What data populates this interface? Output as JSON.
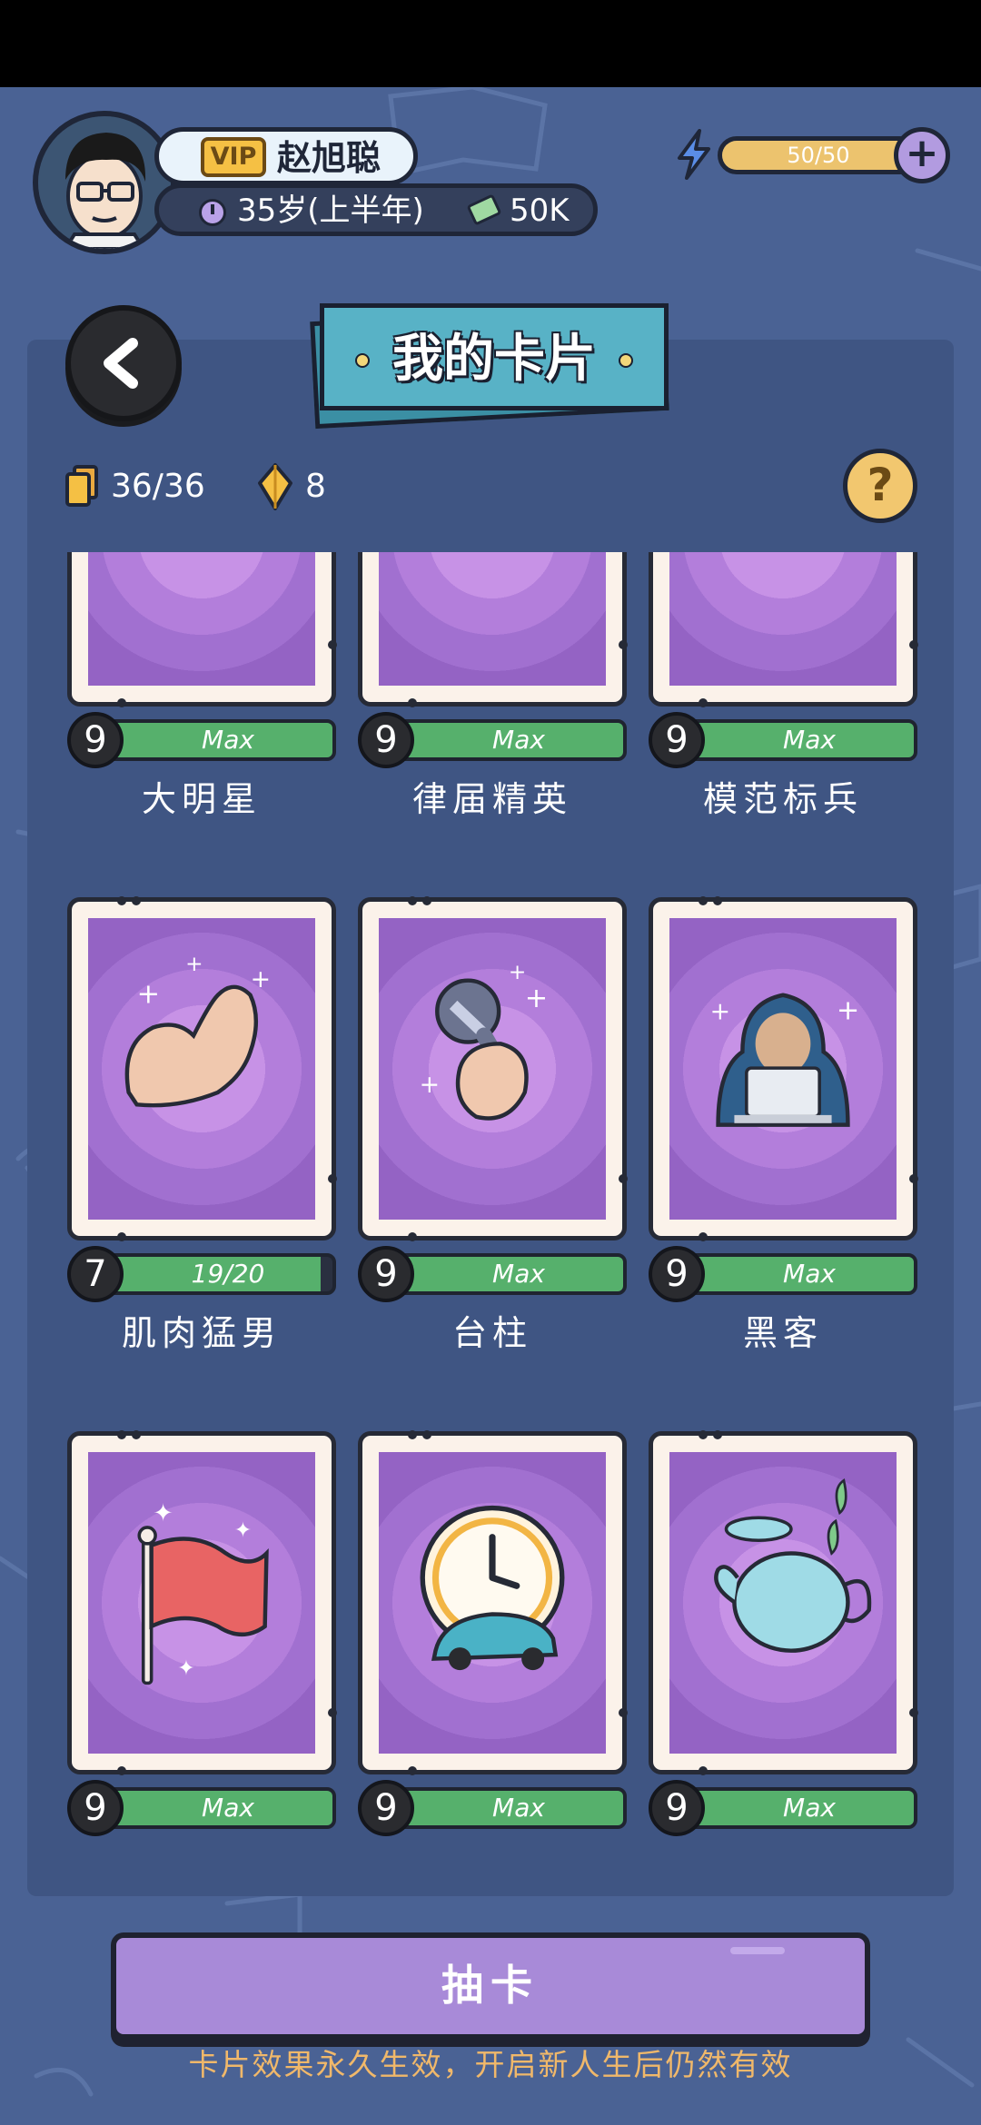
{
  "player": {
    "vip_label": "VIP",
    "name": "赵旭聪",
    "age": "35岁(上半年)",
    "money": "50K"
  },
  "energy": {
    "text": "50/50",
    "fraction": 1.0
  },
  "header": {
    "title": "我的卡片"
  },
  "stats": {
    "cards": "36/36",
    "gems": "8"
  },
  "help_label": "?",
  "cards": [
    {
      "id": "star",
      "name": "大明星",
      "level": "9",
      "progress_label": "Max",
      "progress": 1.0,
      "art": "trophy-icon"
    },
    {
      "id": "lawyer",
      "name": "律届精英",
      "level": "9",
      "progress_label": "Max",
      "progress": 1.0,
      "art": "suit-icon"
    },
    {
      "id": "soldier",
      "name": "模范标兵",
      "level": "9",
      "progress_label": "Max",
      "progress": 1.0,
      "art": "sunglasses-icon"
    },
    {
      "id": "muscle",
      "name": "肌肉猛男",
      "level": "7",
      "progress_label": "19/20",
      "progress": 0.95,
      "art": "flexed-arm-icon"
    },
    {
      "id": "mic",
      "name": "台柱",
      "level": "9",
      "progress_label": "Max",
      "progress": 1.0,
      "art": "microphone-icon"
    },
    {
      "id": "hacker",
      "name": "黑客",
      "level": "9",
      "progress_label": "Max",
      "progress": 1.0,
      "art": "hacker-laptop-icon"
    },
    {
      "id": "flag",
      "name": "",
      "level": "9",
      "progress_label": "Max",
      "progress": 1.0,
      "art": "red-flag-icon"
    },
    {
      "id": "clock",
      "name": "",
      "level": "9",
      "progress_label": "Max",
      "progress": 1.0,
      "art": "clock-car-icon"
    },
    {
      "id": "teapot",
      "name": "",
      "level": "9",
      "progress_label": "Max",
      "progress": 1.0,
      "art": "teapot-icon"
    }
  ],
  "draw_button": "抽卡",
  "footer_note": "卡片效果永久生效，开启新人生后仍然有效",
  "colors": {
    "background": "#4a6294",
    "panel": "#3f5583",
    "progress_fill": "#56b06c",
    "card_purple": "#a170d0",
    "accent_gold": "#f2c76f"
  }
}
